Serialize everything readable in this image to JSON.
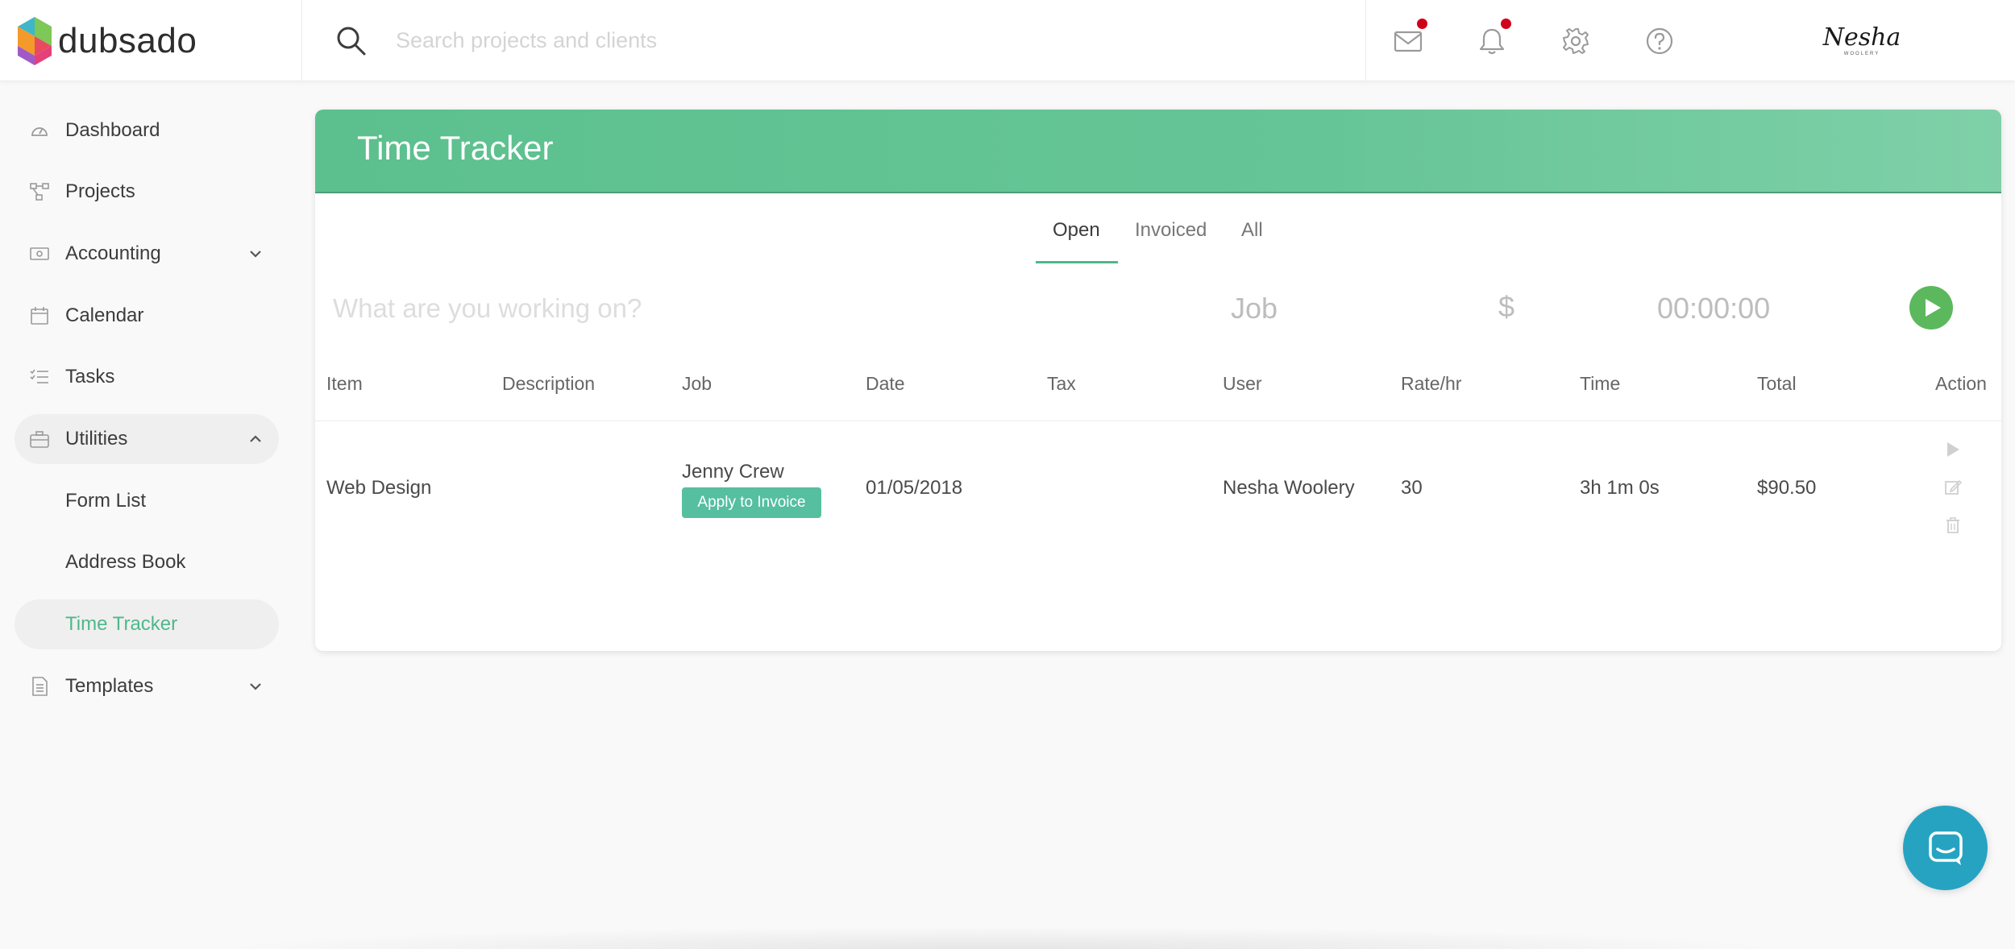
{
  "app": {
    "brand_name": "dubsado",
    "accent_color": "#4fb88a",
    "header_gradient": [
      "#5cc08e",
      "#7fd0a8"
    ]
  },
  "topbar": {
    "search_placeholder": "Search projects and clients",
    "icons": [
      "mail-icon",
      "bell-icon",
      "gear-icon",
      "help-icon"
    ],
    "notification_color": "#d0021b",
    "avatar_signature": "Nesha",
    "avatar_sub": "WOOLERY"
  },
  "sidebar": {
    "items": [
      {
        "label": "Dashboard",
        "icon": "dashboard-icon"
      },
      {
        "label": "Projects",
        "icon": "projects-icon"
      },
      {
        "label": "Accounting",
        "icon": "accounting-icon",
        "chevron": "down"
      },
      {
        "label": "Calendar",
        "icon": "calendar-icon"
      },
      {
        "label": "Tasks",
        "icon": "tasks-icon"
      },
      {
        "label": "Utilities",
        "icon": "utilities-icon",
        "chevron": "up",
        "expanded": true
      },
      {
        "label": "Form List"
      },
      {
        "label": "Address Book"
      },
      {
        "label": "Time Tracker",
        "active": true
      },
      {
        "label": "Templates",
        "icon": "templates-icon",
        "chevron": "down"
      }
    ]
  },
  "main": {
    "title": "Time Tracker",
    "tabs": [
      {
        "label": "Open",
        "active": true
      },
      {
        "label": "Invoiced"
      },
      {
        "label": "All"
      }
    ],
    "entry": {
      "placeholder": "What are you working on?",
      "job_label": "Job",
      "rate_symbol": "$",
      "timer": "00:00:00"
    },
    "columns": [
      "Item",
      "Description",
      "Job",
      "Date",
      "Tax",
      "User",
      "Rate/hr",
      "Time",
      "Total",
      "Action"
    ],
    "rows": [
      {
        "item": "Web Design",
        "description": "",
        "job": "Jenny Crew",
        "job_button": "Apply to Invoice",
        "date": "01/05/2018",
        "tax": "",
        "user": "Nesha Woolery",
        "rate": "30",
        "time": "3h 1m 0s",
        "total": "$90.50"
      }
    ]
  }
}
